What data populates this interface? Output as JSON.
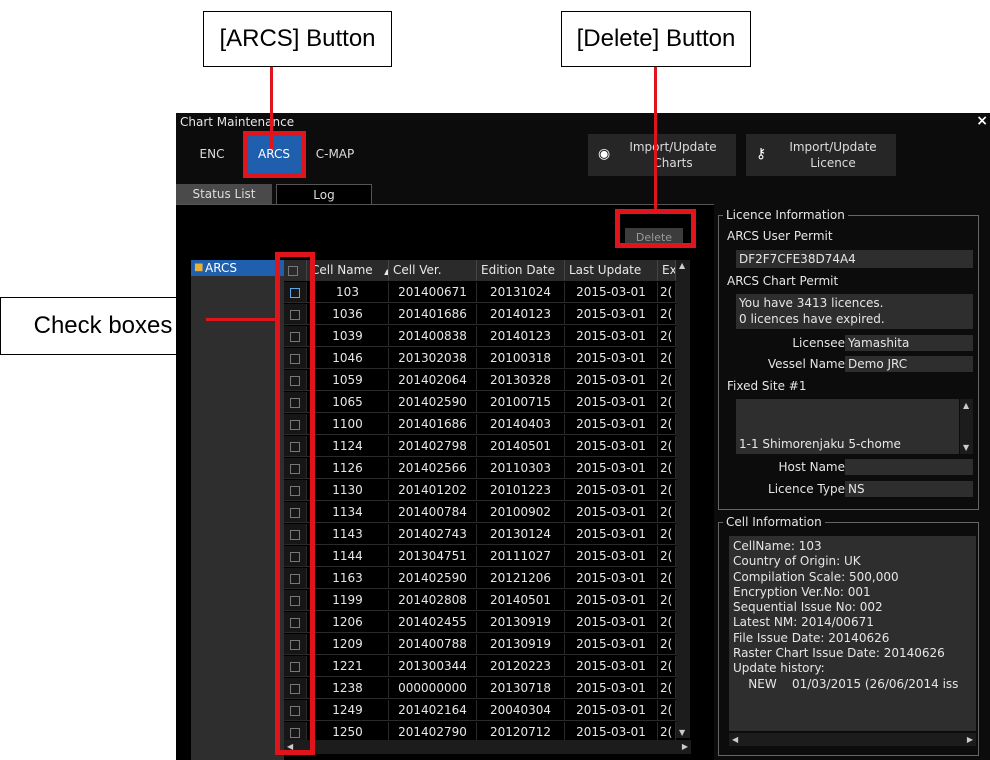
{
  "callouts": {
    "arcs": "[ARCS] Button",
    "delete": "[Delete] Button",
    "check": "Check boxes"
  },
  "window": {
    "title": "Chart Maintenance",
    "close": "×"
  },
  "tabs": [
    "ENC",
    "ARCS",
    "C-MAP"
  ],
  "import_buttons": [
    {
      "label": "Import/Update\nCharts",
      "icon": "disc-icon"
    },
    {
      "label": "Import/Update\nLicence",
      "icon": "key-icon"
    }
  ],
  "subtabs": [
    "Status List",
    "Log"
  ],
  "delete_label": "Delete",
  "tree": {
    "item": "ARCS"
  },
  "table": {
    "headers": [
      "Cell Name",
      "Cell Ver.",
      "Edition Date",
      "Last Update",
      "Ex"
    ],
    "rows": [
      [
        "103",
        "201400671",
        "20131024",
        "2015-03-01",
        "2("
      ],
      [
        "1036",
        "201401686",
        "20140123",
        "2015-03-01",
        "2("
      ],
      [
        "1039",
        "201400838",
        "20140123",
        "2015-03-01",
        "2("
      ],
      [
        "1046",
        "201302038",
        "20100318",
        "2015-03-01",
        "2("
      ],
      [
        "1059",
        "201402064",
        "20130328",
        "2015-03-01",
        "2("
      ],
      [
        "1065",
        "201402590",
        "20100715",
        "2015-03-01",
        "2("
      ],
      [
        "1100",
        "201401686",
        "20140403",
        "2015-03-01",
        "2("
      ],
      [
        "1124",
        "201402798",
        "20140501",
        "2015-03-01",
        "2("
      ],
      [
        "1126",
        "201402566",
        "20110303",
        "2015-03-01",
        "2("
      ],
      [
        "1130",
        "201401202",
        "20101223",
        "2015-03-01",
        "2("
      ],
      [
        "1134",
        "201400784",
        "20100902",
        "2015-03-01",
        "2("
      ],
      [
        "1143",
        "201402743",
        "20130124",
        "2015-03-01",
        "2("
      ],
      [
        "1144",
        "201304751",
        "20111027",
        "2015-03-01",
        "2("
      ],
      [
        "1163",
        "201402590",
        "20121206",
        "2015-03-01",
        "2("
      ],
      [
        "1199",
        "201402808",
        "20140501",
        "2015-03-01",
        "2("
      ],
      [
        "1206",
        "201402455",
        "20130919",
        "2015-03-01",
        "2("
      ],
      [
        "1209",
        "201400788",
        "20130919",
        "2015-03-01",
        "2("
      ],
      [
        "1221",
        "201300344",
        "20120223",
        "2015-03-01",
        "2("
      ],
      [
        "1238",
        "000000000",
        "20130718",
        "2015-03-01",
        "2("
      ],
      [
        "1249",
        "201402164",
        "20040304",
        "2015-03-01",
        "2("
      ],
      [
        "1250",
        "201402790",
        "20120712",
        "2015-03-01",
        "2("
      ]
    ]
  },
  "licence": {
    "title": "Licence Information",
    "user_permit_label": "ARCS User Permit",
    "user_permit": "DF2F7CFE38D74A4",
    "chart_permit_label": "ARCS Chart Permit",
    "chart_permit_line1": "You have 3413 licences.",
    "chart_permit_line2": "0 licences have expired.",
    "licensee_label": "Licensee",
    "licensee": "Yamashita",
    "vessel_label": "Vessel Name",
    "vessel": "Demo JRC",
    "fixed_site_label": "Fixed Site #1",
    "fixed_site": "1-1 Shimorenjaku 5-chome",
    "host_label": "Host Name",
    "host": "",
    "type_label": "Licence Type",
    "type": "NS"
  },
  "cell_info": {
    "title": "Cell Information",
    "lines": [
      "CellName: 103",
      "Country of Origin: UK",
      "Compilation Scale: 500,000",
      "Encryption Ver.No: 001",
      "Sequential Issue No: 002",
      "Latest NM: 2014/00671",
      "File Issue Date: 20140626",
      "Raster Chart Issue Date: 20140626",
      "Update history:",
      "    NEW    01/03/2015 (26/06/2014 iss"
    ]
  },
  "colors": {
    "highlight": "#e1141b",
    "accent": "#1f5fae"
  }
}
